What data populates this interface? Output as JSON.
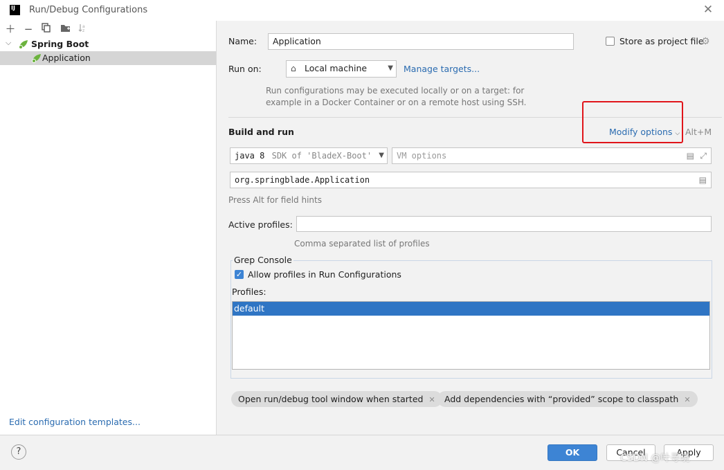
{
  "window": {
    "title": "Run/Debug Configurations",
    "logo": "IJ"
  },
  "sidebar": {
    "toolbar_icons": [
      "plus-icon",
      "minus-icon",
      "copy-icon",
      "folder-icon",
      "sort-icon"
    ],
    "tree": {
      "root_label": "Spring Boot",
      "child_label": "Application"
    },
    "edit_templates_link": "Edit configuration templates..."
  },
  "form": {
    "name_label": "Name:",
    "name_value": "Application",
    "store_label": "Store as project file",
    "run_on_label": "Run on:",
    "run_on_value": "Local machine",
    "manage_targets": "Manage targets...",
    "run_hint_line1": "Run configurations may be executed locally or on a target: for",
    "run_hint_line2": "example in a Docker Container or on a remote host using SSH.",
    "section_title": "Build and run",
    "modify_options": "Modify options",
    "modify_shortcut": "Alt+M",
    "jre_main": "java 8",
    "jre_detail": "SDK of 'BladeX-Boot'",
    "vm_placeholder": "VM options",
    "main_class": "org.springblade.Application",
    "field_hints": "Press Alt for field hints",
    "profiles_label": "Active profiles:",
    "profiles_value": "",
    "profiles_hint": "Comma separated list of profiles",
    "grep_title": "Grep Console",
    "allow_profiles_label": "Allow profiles in Run Configurations",
    "allow_profiles_checked": true,
    "profiles_list_label": "Profiles:",
    "profiles_list": [
      "default"
    ],
    "chips": [
      "Open run/debug tool window when started",
      "Add dependencies with “provided” scope to classpath"
    ]
  },
  "footer": {
    "help": "?",
    "ok": "OK",
    "cancel": "Cancel",
    "apply": "Apply",
    "watermark": "CSDN @叶寻晓"
  },
  "colors": {
    "accent": "#3d84d4",
    "link": "#2a6bb0",
    "annotation": "#e0141a",
    "selection": "#2f75c4"
  }
}
